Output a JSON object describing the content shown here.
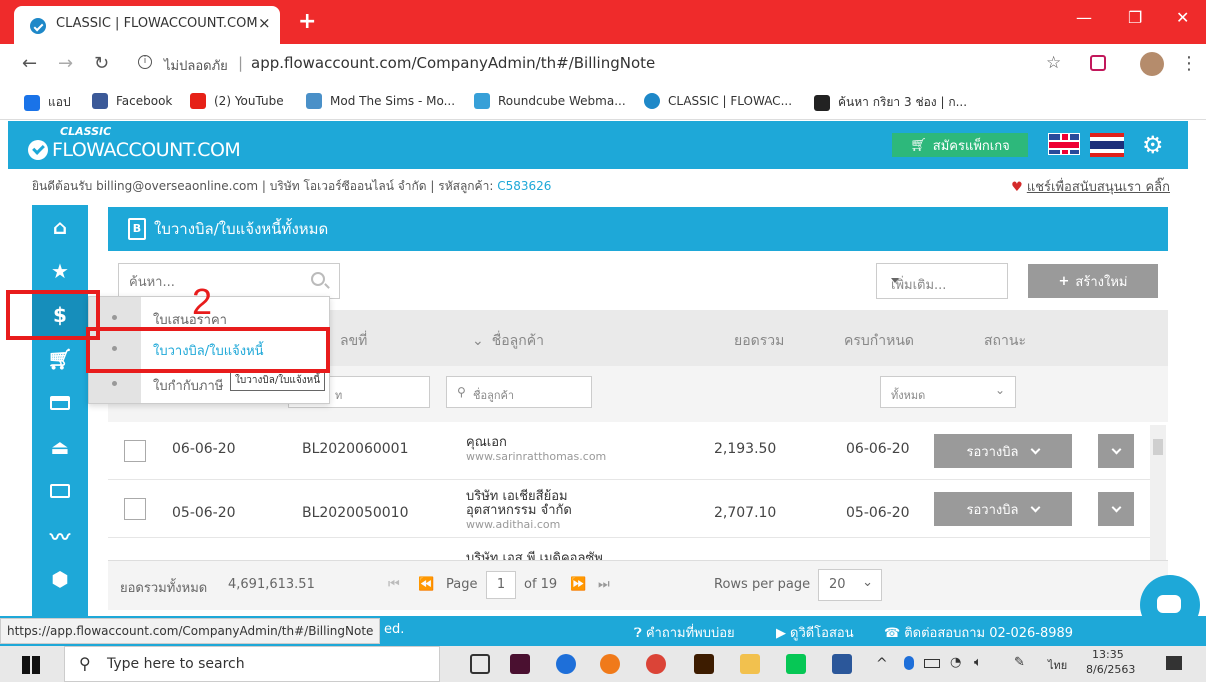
{
  "browser": {
    "tab_title": "CLASSIC | FLOWACCOUNT.COM",
    "tab_close": "×",
    "new_tab": "+",
    "win_minimize": "—",
    "win_maximize": "❐",
    "win_close": "✕",
    "insecure_label": "ไม่ปลอดภัย",
    "url": "app.flowaccount.com/CompanyAdmin/th#/BillingNote",
    "bookmarks": [
      {
        "label": "แอป",
        "color": "#1a73e8"
      },
      {
        "label": "Facebook",
        "color": "#3b5998"
      },
      {
        "label": "(2) YouTube",
        "color": "#e62117"
      },
      {
        "label": "Mod The Sims - Mo...",
        "color": "#4a90c8"
      },
      {
        "label": "Roundcube Webma...",
        "color": "#37a0d8"
      },
      {
        "label": "CLASSIC | FLOWAC...",
        "color": "#1e88c8"
      },
      {
        "label": "ค้นหา กริยา 3 ช่อง | ก...",
        "color": "#222222"
      }
    ]
  },
  "app": {
    "logo_classic": "CLASSIC",
    "logo_main": "FLOWACCOUNT.COM",
    "subscribe_label": "สมัครแพ็กเกจ",
    "welcome_prefix": "ยินดีต้อนรับ billing@overseaonline.com | บริษัท โอเวอร์ซีออนไลน์ จำกัด | รหัสลูกค้า: ",
    "customer_code": "C583626",
    "share_label": "แชร์เพื่อสนับสนุนเรา คลิ๊ก",
    "page_title": "ใบวางบิล/ใบแจ้งหนี้ทั้งหมด",
    "search_placeholder": "ค้นหา...",
    "more_label": "เพิ่มเติม...",
    "create_label": "สร้างใหม่",
    "columns": {
      "doc_no": "ลขที่",
      "customer": "ชื่อลูกค้า",
      "total": "ยอดรวม",
      "due": "ครบกำหนด",
      "status": "สถานะ"
    },
    "filter_doc_placeholder": "ท",
    "filter_customer_placeholder": "ชื่อลูกค้า",
    "filter_status_value": "ทั้งหมด",
    "rows": [
      {
        "date": "06-06-20",
        "doc_no": "BL2020060001",
        "customer": "คุณเอก",
        "customer_line2": "",
        "website": "www.sarinratthomas.com",
        "total": "2,193.50",
        "due": "06-06-20",
        "status": "รอวางบิล"
      },
      {
        "date": "05-06-20",
        "doc_no": "BL2020050010",
        "customer": "บริษัท เอเชียสีย้อม",
        "customer_line2": "อุตสาหกรรม จำกัด",
        "website": "www.adithai.com",
        "total": "2,707.10",
        "due": "05-06-20",
        "status": "รอวางบิล"
      }
    ],
    "partial_row_text": "บริษัท เอส พี เมดิคอลซัพ",
    "footer": {
      "grand_total_label": "ยอดรวมทั้งหมด",
      "grand_total": "4,691,613.51",
      "page_label": "Page",
      "page_value": "1",
      "of_label": "of 19",
      "rows_per_page_label": "Rows per page",
      "rows_per_page": "20"
    },
    "bottom_links": {
      "faq": "คำถามที่พบบ่อย",
      "video": "ดูวิดีโอสอน",
      "contact": "ติดต่อสอบถาม 02-026-8989",
      "trail": "ed."
    },
    "status_url": "https://app.flowaccount.com/CompanyAdmin/th#/BillingNote"
  },
  "menu": {
    "items": [
      {
        "label": "ใบเสนอราคา"
      },
      {
        "label": "ใบวางบิล/ใบแจ้งหนี้"
      },
      {
        "label": "ใบกำกับภาษี"
      }
    ],
    "tooltip": "ใบวางบิล/ใบแจ้งหนี้"
  },
  "annotation": {
    "step_number": "2"
  },
  "taskbar": {
    "search_placeholder": "Type here to search",
    "lang": "ไทย",
    "time": "13:35",
    "date": "8/6/2563"
  },
  "colors": {
    "brand": "#1ea8d8",
    "chrome_red": "#ef2b2b",
    "annotation_red": "#e81c1c",
    "status_gray": "#9a9a9a"
  }
}
